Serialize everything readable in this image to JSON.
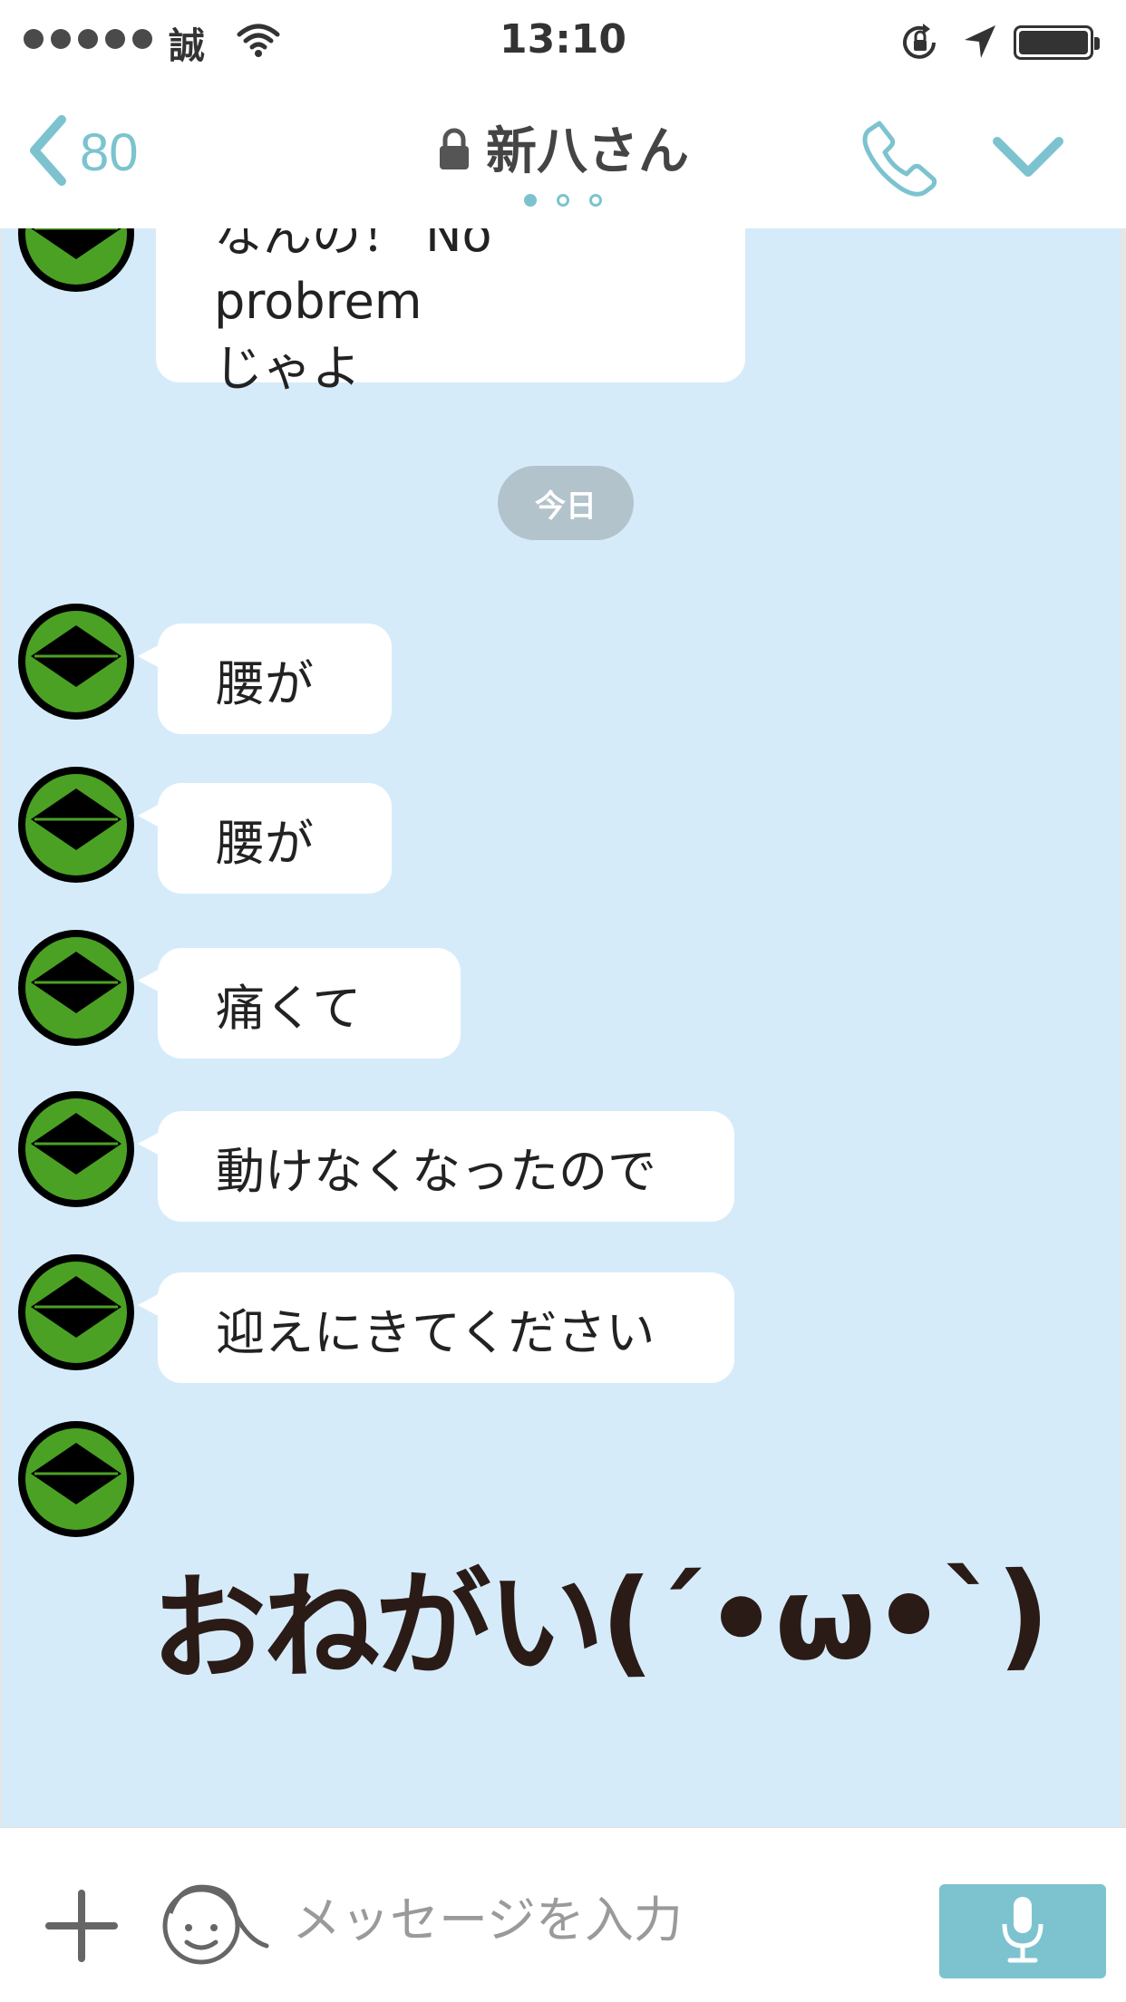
{
  "status_bar": {
    "carrier": "誠",
    "time": "13:10"
  },
  "nav": {
    "back_count": "80",
    "title": "新八さん"
  },
  "colors": {
    "accent": "#7cc3cf",
    "chat_background": "#d6ebfa",
    "avatar_green": "#4ba124",
    "date_pill": "#b3c3cc"
  },
  "chat": {
    "previous_message": "なんの！ No probrem\nじゃよ",
    "date_separator": "今日",
    "messages": [
      {
        "text": "腰が"
      },
      {
        "text": "腰が"
      },
      {
        "text": "痛くて"
      },
      {
        "text": "動けなくなったので"
      },
      {
        "text": "迎えにきてください"
      }
    ],
    "sticker_text": "おねがい(´•ω•`)"
  },
  "input": {
    "placeholder": "メッセージを入力"
  },
  "icons": [
    "back-chevron-icon",
    "lock-icon",
    "phone-icon",
    "chevron-down-icon",
    "plus-icon",
    "emoji-face-icon",
    "microphone-icon",
    "wifi-icon",
    "rotation-lock-icon",
    "location-arrow-icon",
    "battery-icon"
  ]
}
